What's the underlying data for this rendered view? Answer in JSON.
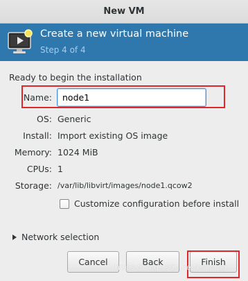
{
  "window": {
    "title": "New VM"
  },
  "banner": {
    "title": "Create a new virtual machine",
    "step": "Step 4 of 4",
    "icon": "monitor-icon"
  },
  "summary": {
    "heading": "Ready to begin the installation",
    "name_label": "Name:",
    "name_value": "node1",
    "os_label": "OS:",
    "os_value": "Generic",
    "install_label": "Install:",
    "install_value": "Import existing OS image",
    "memory_label": "Memory:",
    "memory_value": "1024 MiB",
    "cpus_label": "CPUs:",
    "cpus_value": "1",
    "storage_label": "Storage:",
    "storage_value": "/var/lib/libvirt/images/node1.qcow2"
  },
  "customize": {
    "label": "Customize configuration before install",
    "checked": false
  },
  "network": {
    "label": "Network selection"
  },
  "buttons": {
    "cancel": "Cancel",
    "back": "Back",
    "finish": "Finish"
  },
  "watermark": "https://blog.csdn.net/nsilorag",
  "colors": {
    "banner": "#2f78ae",
    "highlight": "#e0262b",
    "focus": "#4a90d9"
  }
}
